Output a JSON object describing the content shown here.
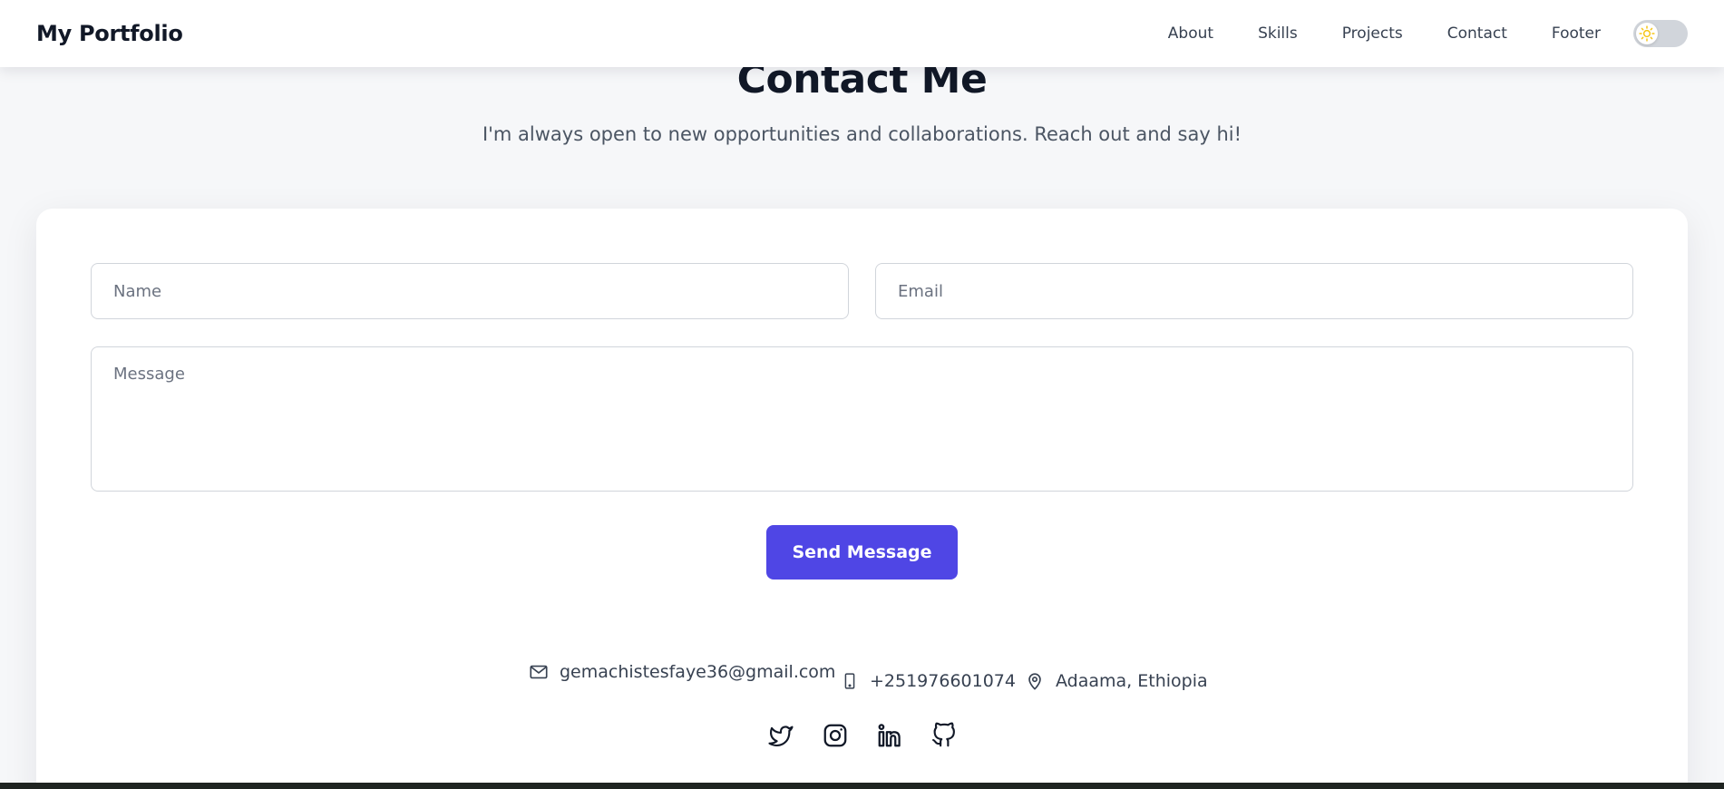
{
  "navbar": {
    "brand": "My Portfolio",
    "links": [
      "About",
      "Skills",
      "Projects",
      "Contact",
      "Footer"
    ],
    "theme_toggle_icon": "sun-icon"
  },
  "contact": {
    "title": "Contact Me",
    "subtitle": "I'm always open to new opportunities and collaborations. Reach out and say hi!",
    "form": {
      "name_placeholder": "Name",
      "name_value": "",
      "email_placeholder": "Email",
      "email_value": "",
      "message_placeholder": "Message",
      "message_value": "",
      "submit_label": "Send Message"
    },
    "info": {
      "email": "gemachistesfaye36@gmail.com",
      "email_icon": "mail-icon",
      "phone": "+251976601074",
      "phone_icon": "phone-icon",
      "location": "Adaama, Ethiopia",
      "location_icon": "map-pin-icon"
    },
    "socials": [
      "twitter-icon",
      "instagram-icon",
      "linkedin-icon",
      "github-icon"
    ]
  },
  "colors": {
    "accent": "#4f46e5",
    "page_background": "#f6f7f9",
    "card_background": "#ffffff",
    "heading": "#111827",
    "body_text": "#4b5563",
    "sun": "#f5c518"
  }
}
